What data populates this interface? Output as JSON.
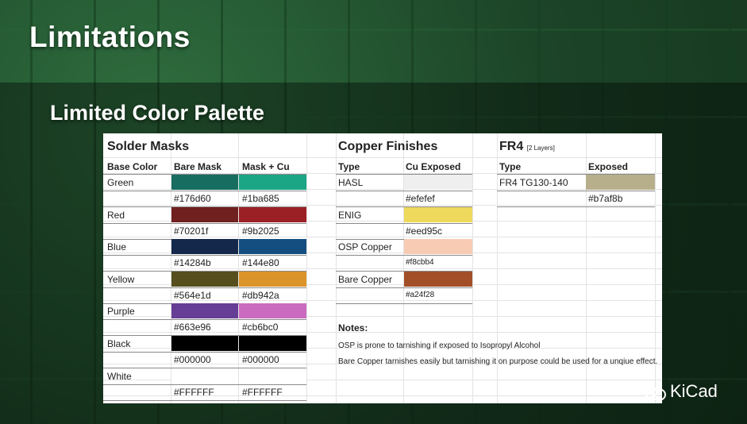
{
  "title": "Limitations",
  "subtitle": "Limited Color Palette",
  "solder": {
    "title": "Solder Masks",
    "headers": [
      "Base Color",
      "Bare Mask",
      "Mask + Cu"
    ],
    "rows": [
      {
        "name": "Green",
        "bare": "#176d60",
        "cu": "#1ba685"
      },
      {
        "name": "Red",
        "bare": "#70201f",
        "cu": "#9b2025"
      },
      {
        "name": "Blue",
        "bare": "#14284b",
        "cu": "#144e80"
      },
      {
        "name": "Yellow",
        "bare": "#564e1d",
        "cu": "#db942a"
      },
      {
        "name": "Purple",
        "bare": "#663e96",
        "cu": "#cb6bc0"
      },
      {
        "name": "Black",
        "bare": "#000000",
        "cu": "#000000"
      },
      {
        "name": "White",
        "bare": "#FFFFFF",
        "cu": "#FFFFFF"
      }
    ]
  },
  "copper": {
    "title": "Copper Finishes",
    "headers": [
      "Type",
      "Cu Exposed"
    ],
    "rows": [
      {
        "name": "HASL",
        "color": "#efefef"
      },
      {
        "name": "ENIG",
        "color": "#eed95c"
      },
      {
        "name": "OSP Copper",
        "color": "#f8cbb4"
      },
      {
        "name": "Bare Copper",
        "color": "#a24f28"
      }
    ]
  },
  "fr4": {
    "title": "FR4",
    "subtitle": "[2 Layers]",
    "headers": [
      "Type",
      "Exposed"
    ],
    "rows": [
      {
        "name": "FR4 TG130-140",
        "color": "#b7af8b"
      }
    ]
  },
  "notes": {
    "title": "Notes:",
    "items": [
      "OSP is prone to tarnishing if exposed to Isopropyl Alcohol",
      "Bare Copper tarnishes easily but tarnishing it on purpose could be used for a unqiue effect."
    ]
  },
  "logo": {
    "text": "KiCad"
  }
}
